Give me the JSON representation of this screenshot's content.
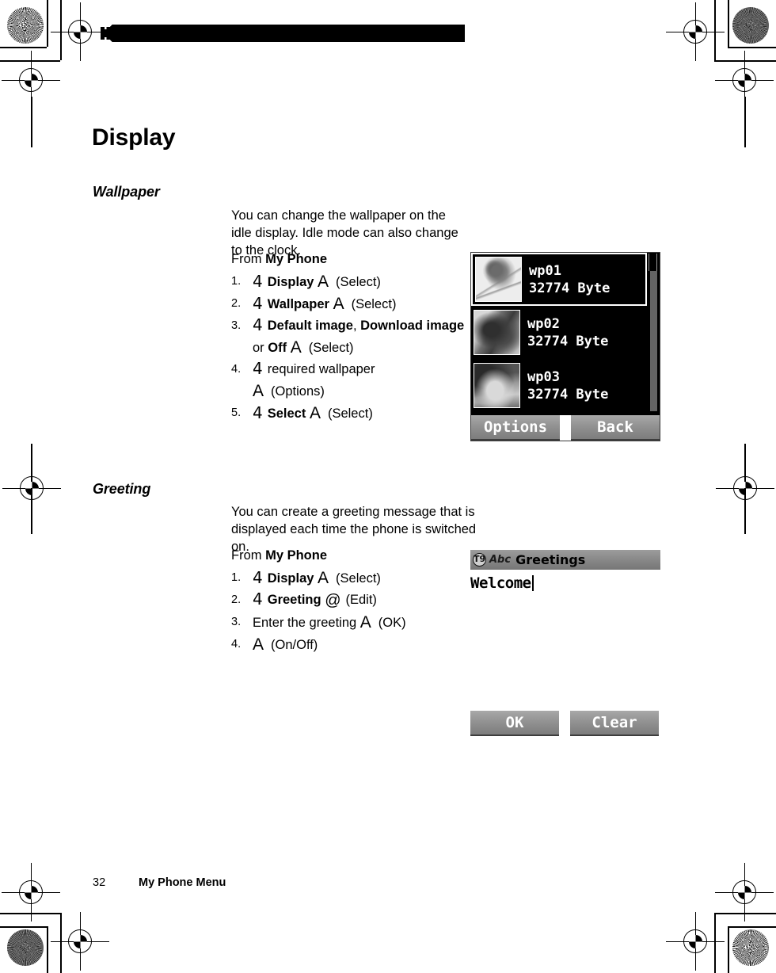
{
  "document": {
    "page_title": "Display",
    "footer": {
      "page_number": "32",
      "section_label": "My Phone Menu"
    }
  },
  "sections": [
    {
      "heading": "Wallpaper",
      "intro": "You can change the wallpaper on the idle display. Idle mode can also change to the clock.",
      "from_prefix": "From ",
      "from_menu": "My Phone",
      "steps": [
        {
          "num": "1.",
          "key_symbol": "4",
          "bold_text": "Display",
          "action_symbol": "A",
          "paren": "(Select)"
        },
        {
          "num": "2.",
          "key_symbol": "4",
          "bold_text": "Wallpaper",
          "action_symbol": "A",
          "paren": "(Select)"
        },
        {
          "num": "3.",
          "key_symbol": "4",
          "bold_text": "Default image",
          "sep": ", ",
          "bold_text2": "Download image",
          "mid_text": " or ",
          "bold_text3": "Off",
          "action_symbol": "A",
          "paren": "(Select)"
        },
        {
          "num": "4.",
          "key_symbol": "4",
          "plain_text": "required wallpaper",
          "action_symbol": "A",
          "paren": "(Options)"
        },
        {
          "num": "5.",
          "key_symbol": "4",
          "bold_text": "Select",
          "action_symbol": "A",
          "paren": "(Select)"
        }
      ]
    },
    {
      "heading": "Greeting",
      "intro": "You can create a greeting message that is displayed each time the phone is switched on.",
      "from_prefix": "From ",
      "from_menu": "My Phone",
      "steps": [
        {
          "num": "1.",
          "key_symbol": "4",
          "bold_text": "Display",
          "action_symbol": "A",
          "paren": "(Select)"
        },
        {
          "num": "2.",
          "key_symbol": "4",
          "bold_text": "Greeting",
          "action_symbol": "@",
          "paren": "(Edit)"
        },
        {
          "num": "3.",
          "plain_text": "Enter the greeting",
          "action_symbol": "A",
          "paren": "(OK)"
        },
        {
          "num": "4.",
          "action_symbol": "A",
          "paren": "(On/Off)"
        }
      ]
    }
  ],
  "wallpaper_screen": {
    "rows": [
      {
        "name": "wp01",
        "size": "32774 Byte",
        "thumb": "flower-thumbnail",
        "selected": true
      },
      {
        "name": "wp02",
        "size": "32774 Byte",
        "thumb": "butterfly-thumbnail",
        "selected": false
      },
      {
        "name": "wp03",
        "size": "32774 Byte",
        "thumb": "cat-thumbnail",
        "selected": false
      }
    ],
    "softkeys": {
      "left": "Options",
      "right": "Back"
    },
    "colors": {
      "background": "#000000",
      "text": "#ffffff",
      "softkey": "#8e8e8e"
    }
  },
  "greeting_screen": {
    "titlebar": {
      "icon_t9": "T9",
      "icon_abc": "Abc",
      "title": "Greetings"
    },
    "input_value": "Welcome",
    "softkeys": {
      "left": "OK",
      "right": "Clear"
    },
    "colors": {
      "titlebar": "#8a8a8a",
      "background": "#ffffff",
      "text": "#000000"
    }
  },
  "print_marks": {
    "top_pattern": "zigzag-decorative-rule"
  }
}
